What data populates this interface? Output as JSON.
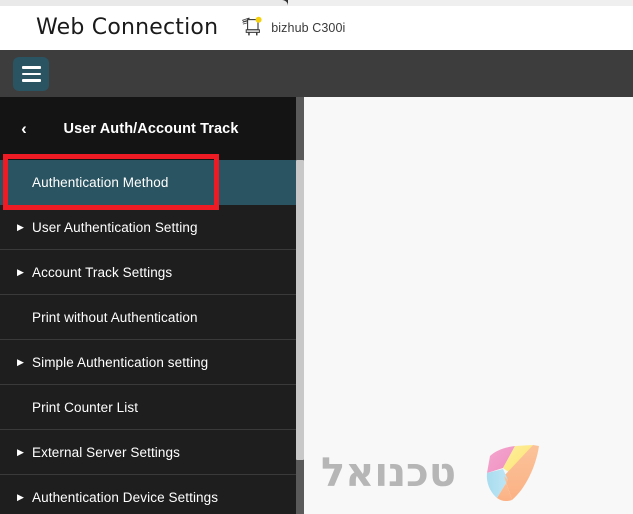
{
  "window": {
    "chrome_visible": true
  },
  "header": {
    "brand_title": "Web Connection",
    "device_icon": "printer-mfp-icon",
    "device_name": "bizhub C300i",
    "status_dot_color": "#f5d10d"
  },
  "topbar": {
    "menu_icon": "hamburger-menu-icon",
    "menu_button_color": "#2a5461",
    "background_color": "#3d3d3d"
  },
  "sidebar": {
    "back_icon": "chevron-left-icon",
    "title": "User Auth/Account Track",
    "background_color": "#1e1e1e",
    "selected_color": "#2a5461",
    "items": [
      {
        "label": "Authentication Method",
        "expandable": false,
        "selected": true
      },
      {
        "label": "User Authentication Setting",
        "expandable": true,
        "selected": false
      },
      {
        "label": "Account Track Settings",
        "expandable": true,
        "selected": false
      },
      {
        "label": "Print without Authentication",
        "expandable": false,
        "selected": false
      },
      {
        "label": "Simple Authentication setting",
        "expandable": true,
        "selected": false
      },
      {
        "label": "Print Counter List",
        "expandable": false,
        "selected": false
      },
      {
        "label": "External Server Settings",
        "expandable": true,
        "selected": false
      },
      {
        "label": "Authentication Device Settings",
        "expandable": true,
        "selected": false
      }
    ],
    "scrollbar": {
      "visible": true,
      "thumb_color": "#c8c8c8",
      "track_color": "#5a5a5a"
    }
  },
  "annotation": {
    "type": "highlight-rectangle",
    "color": "#ee1b24",
    "target": "Authentication Method"
  },
  "content": {
    "background_color": "#f8f8f8",
    "watermark_text": "טכנואל",
    "watermark_logo": "technoel-logo-icon",
    "watermark_text_color": "#b6b6b6"
  }
}
